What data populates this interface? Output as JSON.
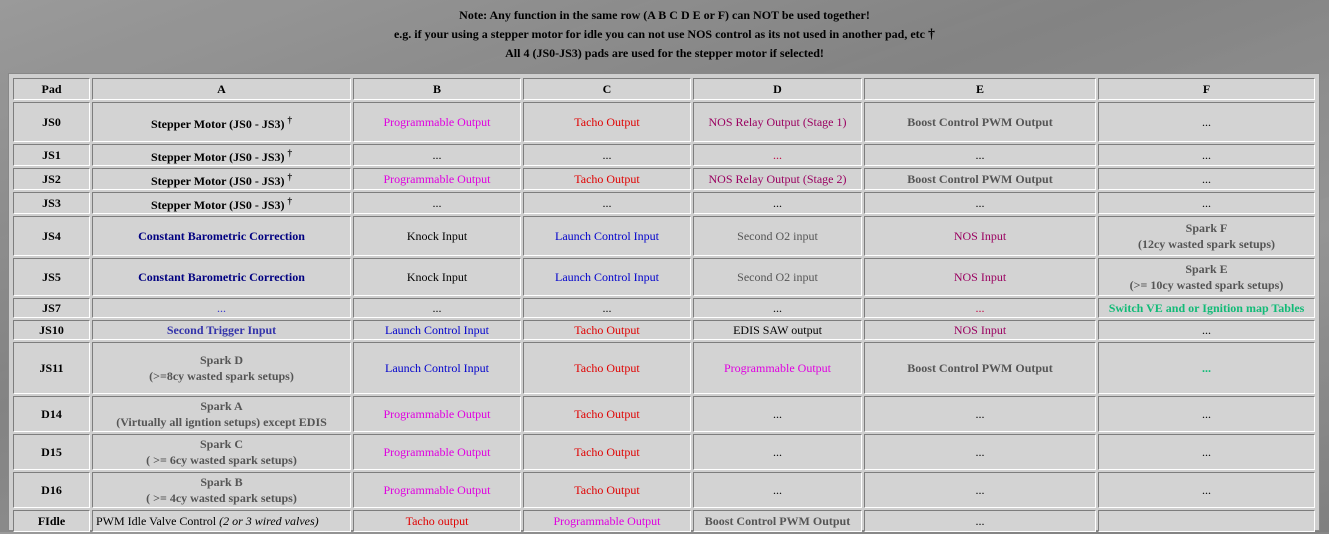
{
  "notes": {
    "line1": "Note: Any function in the same row (A B C D E or F) can NOT be used together!",
    "line2": "e.g. if your using a stepper motor for idle you can not use NOS control as its not used in another pad, etc",
    "line2_mark": "†",
    "line3": "All 4 (JS0-JS3) pads are used for the stepper motor if selected!"
  },
  "table": {
    "headers": [
      "Pad",
      "A",
      "B",
      "C",
      "D",
      "E",
      "F"
    ],
    "rows": [
      {
        "pad": "JS0",
        "a": "Stepper Motor (JS0 - JS3)",
        "a_mark": "†",
        "b": "Programmable Output",
        "c": "Tacho Output",
        "d": "NOS Relay Output (Stage 1)",
        "e": "Boost Control PWM Output",
        "f": "..."
      },
      {
        "pad": "JS1",
        "a": "Stepper Motor (JS0 - JS3)",
        "a_mark": "†",
        "b": "...",
        "c": "...",
        "d": "...",
        "e": "...",
        "f": "..."
      },
      {
        "pad": "JS2",
        "a": "Stepper Motor (JS0 - JS3)",
        "a_mark": "†",
        "b": "Programmable Output",
        "c": "Tacho Output",
        "d": "NOS Relay Output (Stage 2)",
        "e": "Boost Control PWM Output",
        "f": "..."
      },
      {
        "pad": "JS3",
        "a": "Stepper Motor (JS0 - JS3)",
        "a_mark": "†",
        "b": "...",
        "c": "...",
        "d": "...",
        "e": "...",
        "f": "..."
      },
      {
        "pad": "JS4",
        "a": "Constant Barometric Correction",
        "b": "Knock Input",
        "c": "Launch Control Input",
        "d": "Second O2 input",
        "e": "NOS Input",
        "f1": "Spark F",
        "f2": "(12cy wasted spark setups)"
      },
      {
        "pad": "JS5",
        "a": "Constant Barometric Correction",
        "b": "Knock Input",
        "c": "Launch Control Input",
        "d": "Second O2 input",
        "e": "NOS Input",
        "f1": "Spark E",
        "f2": "(>= 10cy wasted spark setups)"
      },
      {
        "pad": "JS7",
        "a": "...",
        "b": "...",
        "c": "...",
        "d": "...",
        "e": "...",
        "f": "Switch VE and or Ignition map Tables"
      },
      {
        "pad": "JS10",
        "a": "Second Trigger Input",
        "b": "Launch Control Input",
        "c": "Tacho Output",
        "d": "EDIS SAW output",
        "e": "NOS Input",
        "f": "..."
      },
      {
        "pad": "JS11",
        "a1": "Spark D",
        "a2": "(>=8cy wasted spark setups)",
        "b": "Launch Control Input",
        "c": "Tacho Output",
        "d": "Programmable Output",
        "e": "Boost Control PWM Output",
        "f": "..."
      },
      {
        "pad": "D14",
        "a1": "Spark A",
        "a2": "(Virtually all igntion setups) except EDIS",
        "b": "Programmable Output",
        "c": "Tacho Output",
        "d": "...",
        "e": "...",
        "f": "..."
      },
      {
        "pad": "D15",
        "a1": "Spark C",
        "a2": "( >= 6cy wasted spark setups)",
        "b": "Programmable Output",
        "c": "Tacho Output",
        "d": "...",
        "e": "...",
        "f": "..."
      },
      {
        "pad": "D16",
        "a1": "Spark B",
        "a2": "( >= 4cy wasted spark setups)",
        "b": "Programmable Output",
        "c": "Tacho Output",
        "d": "...",
        "e": "...",
        "f": "..."
      },
      {
        "pad": "FIdle",
        "a": "PWM Idle Valve Control",
        "a_note": "(2 or 3 wired valves)",
        "b": "Tacho output",
        "c": "Programmable Output",
        "d": "Boost Control PWM Output",
        "e": "...",
        "f": ""
      }
    ]
  },
  "colors": {
    "programmable": "#e000e0",
    "tacho": "#e00000",
    "nos": "#9a0060",
    "boost": "#555555",
    "barometric": "#000080",
    "launch": "#0000cc",
    "switch_tables": "#11bb77"
  }
}
